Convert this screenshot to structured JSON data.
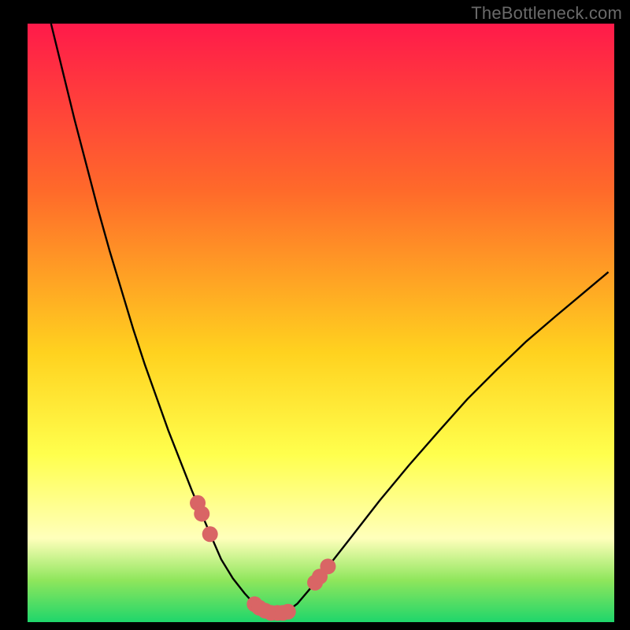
{
  "watermark": "TheBottleneck.com",
  "colors": {
    "frame": "#000000",
    "gradient_top": "#ff1a4a",
    "gradient_mid1": "#ff6a2a",
    "gradient_mid2": "#ffd21f",
    "gradient_mid3": "#ffff4d",
    "gradient_white": "#ffffbb",
    "gradient_green1": "#8fe65c",
    "gradient_green2": "#1fd66b",
    "curve": "#000000",
    "markers": "#d96565"
  },
  "plot": {
    "inner_x": 35,
    "inner_y": 30,
    "inner_w": 745,
    "inner_h": 760
  },
  "chart_data": {
    "type": "line",
    "title": "",
    "xlabel": "",
    "ylabel": "",
    "x_range": [
      0,
      100
    ],
    "y_range": [
      0,
      100
    ],
    "curve": {
      "x": [
        4,
        6,
        8,
        10,
        12,
        14,
        16,
        18,
        20,
        22,
        24,
        26,
        28,
        29.5,
        31,
        33,
        35,
        37,
        38.5,
        39.2,
        40,
        42,
        44,
        46,
        48,
        51,
        55,
        60,
        65,
        70,
        75,
        80,
        85,
        90,
        95,
        99
      ],
      "y": [
        100,
        92,
        84,
        76.5,
        69,
        62,
        55.5,
        49,
        43,
        37.5,
        32,
        27,
        22,
        18.5,
        15,
        10.5,
        7.3,
        4.8,
        3.2,
        2.6,
        2.1,
        1.4,
        1.6,
        3.1,
        5.4,
        9.0,
        14.0,
        20.3,
        26.2,
        31.8,
        37.3,
        42.2,
        46.9,
        51.1,
        55.2,
        58.5
      ]
    },
    "markers": [
      {
        "x": 29.0,
        "y": 19.9
      },
      {
        "x": 29.7,
        "y": 18.1
      },
      {
        "x": 31.1,
        "y": 14.7
      },
      {
        "x": 38.7,
        "y": 3.0
      },
      {
        "x": 39.5,
        "y": 2.4
      },
      {
        "x": 40.5,
        "y": 1.9
      },
      {
        "x": 41.5,
        "y": 1.55
      },
      {
        "x": 42.6,
        "y": 1.55
      },
      {
        "x": 43.5,
        "y": 1.55
      },
      {
        "x": 44.4,
        "y": 1.75
      },
      {
        "x": 49.0,
        "y": 6.6
      },
      {
        "x": 49.8,
        "y": 7.6
      },
      {
        "x": 51.2,
        "y": 9.3
      }
    ],
    "marker_radius_px": 10
  }
}
